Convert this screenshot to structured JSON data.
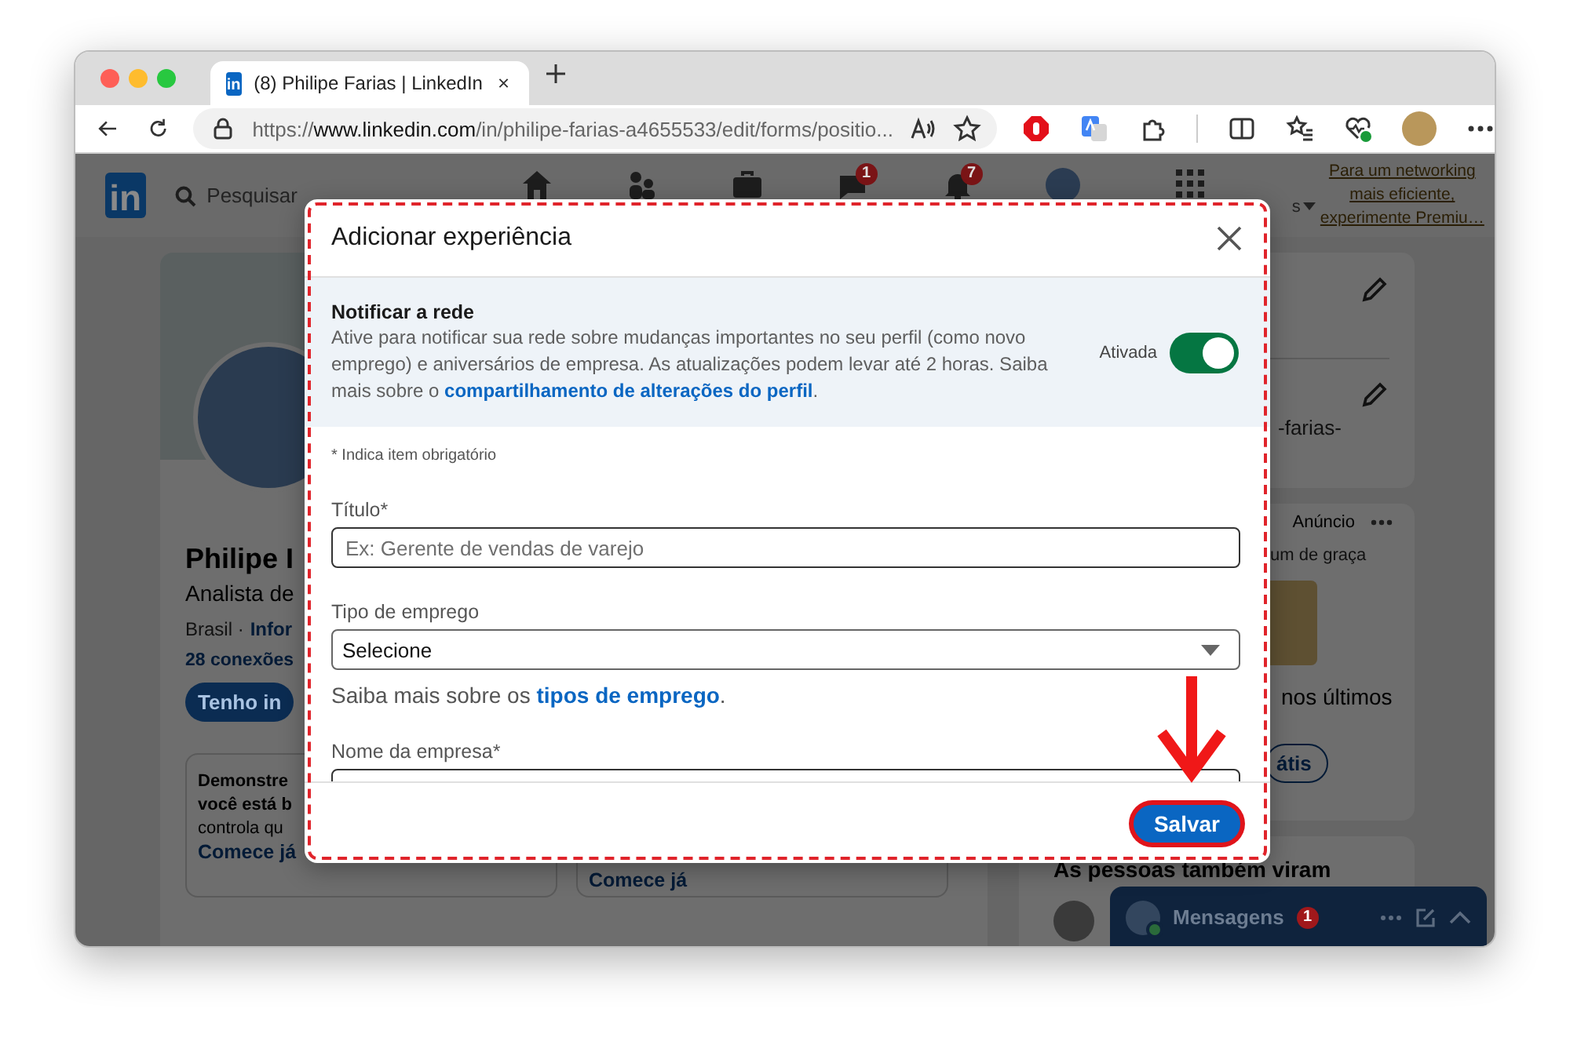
{
  "browser": {
    "tab_title": "(8) Philipe Farias | LinkedIn",
    "favicon_text": "in",
    "url": {
      "scheme": "https://",
      "host": "www.linkedin.com",
      "path": "/in/philipe-farias-a4655533/edit/forms/positio..."
    }
  },
  "page": {
    "logo_text": "in",
    "search_placeholder": "Pesquisar",
    "nav": [
      {
        "kind": "home"
      },
      {
        "kind": "network"
      },
      {
        "kind": "jobs"
      },
      {
        "kind": "messaging",
        "badge": "1"
      },
      {
        "kind": "notifications",
        "badge": "7"
      },
      {
        "kind": "me"
      }
    ],
    "nav_fragment": "s",
    "premium_link": "Para um networking mais eficiente, experimente Premiu…"
  },
  "profile": {
    "name": "Philipe I",
    "headline": "Analista de",
    "location": "Brasil ·",
    "location_link": "Infor",
    "connections": "28 conexões",
    "open_button": "Tenho in"
  },
  "promo_cards": [
    {
      "lines": [
        {
          "kind": "bold",
          "text": "Demonstre"
        },
        {
          "kind": "bold",
          "text": "você está b"
        },
        {
          "kind": "plain",
          "text": "controla qu"
        },
        {
          "kind": "link",
          "text": "Comece já"
        }
      ]
    },
    {
      "lines": [
        {
          "kind": "link",
          "text": "Comece já"
        }
      ]
    }
  ],
  "sidebar": {
    "url_fragment": "-farias-",
    "ad": {
      "label": "Anúncio",
      "text_1": "um de graça",
      "text_2": "nos últimos",
      "button": "átis"
    },
    "people_heading": "As pessoas também viram"
  },
  "messaging": {
    "label": "Mensagens",
    "badge": "1"
  },
  "modal": {
    "title": "Adicionar experiência",
    "notify": {
      "title": "Notificar a rede",
      "description": "Ative para notificar sua rede sobre mudanças importantes no seu perfil (como novo emprego) e aniversários de empresa. As atualizações podem levar até 2 horas. Saiba mais sobre o ",
      "link": "compartilhamento de alterações do perfil",
      "after": ".",
      "toggle": {
        "label": "Ativada",
        "on": true
      }
    },
    "required_note": "* Indica item obrigatório",
    "fields": [
      {
        "kind": "text",
        "label": "Título*",
        "placeholder": "Ex: Gerente de vendas de varejo"
      },
      {
        "kind": "select",
        "label": "Tipo de emprego",
        "value": "Selecione",
        "help": "Saiba mais sobre os ",
        "help_link": "tipos de emprego",
        "help_after": "."
      },
      {
        "kind": "text",
        "label": "Nome da empresa*"
      }
    ],
    "save_button": "Salvar"
  }
}
